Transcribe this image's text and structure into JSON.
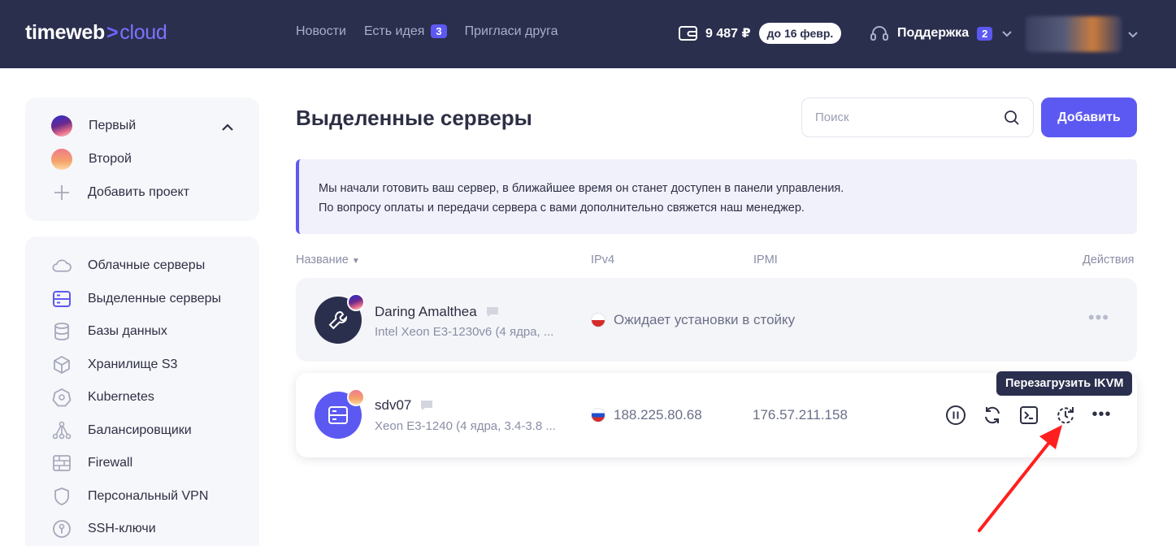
{
  "header": {
    "logo_main": "timeweb",
    "logo_arrow": ">",
    "logo_cloud": "cloud",
    "nav": [
      {
        "label": "Новости"
      },
      {
        "label": "Есть идея",
        "badge": "3"
      },
      {
        "label": "Пригласи друга"
      }
    ],
    "balance": "9 487 ₽",
    "balance_until": "до 16 февр.",
    "support_label": "Поддержка",
    "support_badge": "2"
  },
  "sidebar": {
    "projects": [
      {
        "label": "Первый"
      },
      {
        "label": "Второй"
      },
      {
        "label": "Добавить проект"
      }
    ],
    "menu": [
      {
        "label": "Облачные серверы",
        "icon": "cloud-icon"
      },
      {
        "label": "Выделенные серверы",
        "icon": "server-icon"
      },
      {
        "label": "Базы данных",
        "icon": "database-icon"
      },
      {
        "label": "Хранилище S3",
        "icon": "cube-icon"
      },
      {
        "label": "Kubernetes",
        "icon": "kubernetes-icon"
      },
      {
        "label": "Балансировщики",
        "icon": "balancer-icon"
      },
      {
        "label": "Firewall",
        "icon": "firewall-icon"
      },
      {
        "label": "Персональный VPN",
        "icon": "shield-icon"
      },
      {
        "label": "SSH-ключи",
        "icon": "key-icon"
      }
    ]
  },
  "main": {
    "title": "Выделенные серверы",
    "search_placeholder": "Поиск",
    "add_button": "Добавить",
    "notice_line1": "Мы начали готовить ваш сервер, в ближайшее время он станет доступен в панели управления.",
    "notice_line2": "По вопросу оплаты и передачи сервера с вами дополнительно свяжется наш менеджер.",
    "columns": {
      "name": "Название",
      "ipv4": "IPv4",
      "ipmi": "IPMI",
      "actions": "Действия"
    },
    "servers": [
      {
        "name": "Daring Amalthea",
        "spec": "Intel Xeon E3-1230v6 (4 ядра, ...",
        "status": "Ожидает установки в стойку",
        "ipmi": ""
      },
      {
        "name": "sdv07",
        "spec": "Xeon E3-1240 (4 ядра, 3.4-3.8 ...",
        "ipv4": "188.225.80.68",
        "ipmi": "176.57.211.158"
      }
    ],
    "tooltip": "Перезагрузить IKVM"
  },
  "colors": {
    "header_bg": "#2b2f4e",
    "accent": "#5c59f2",
    "annotation_arrow": "#ff1f1f"
  }
}
